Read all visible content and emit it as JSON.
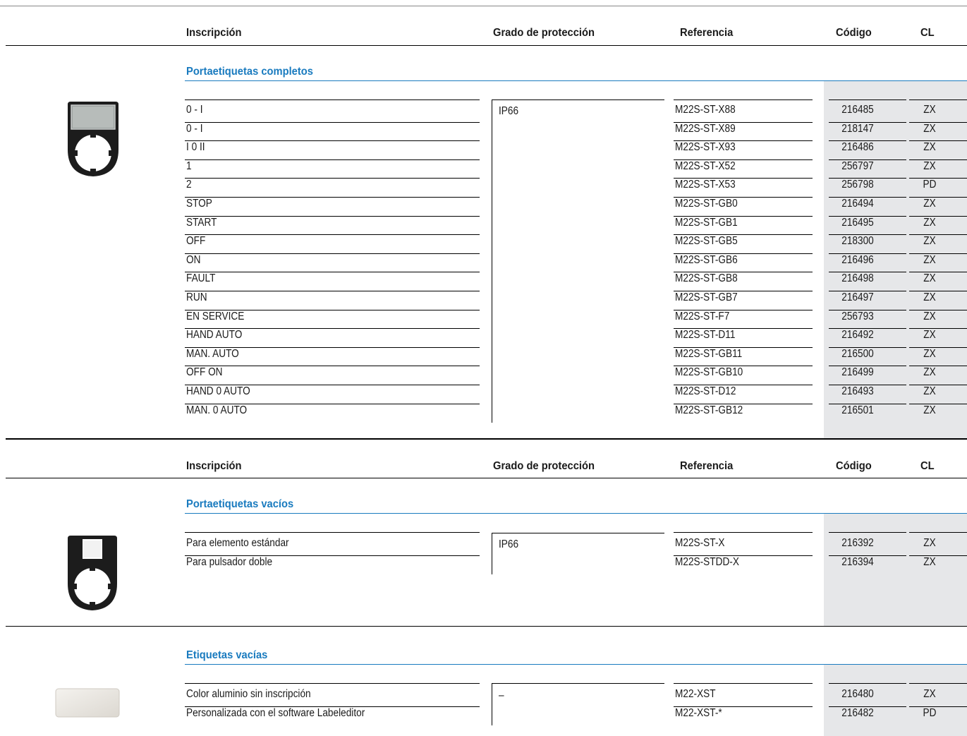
{
  "headers": {
    "inscripcion": "Inscripción",
    "grado": "Grado de protección",
    "referencia": "Referencia",
    "codigo": "Código",
    "cl": "CL"
  },
  "sections": {
    "completos": {
      "title": "Portaetiquetas completos",
      "protection": "IP66",
      "rows": [
        {
          "inscripcion": "0 - I",
          "referencia": "M22S-ST-X88",
          "codigo": "216485",
          "cl": "ZX"
        },
        {
          "inscripcion": "0 - I",
          "referencia": "M22S-ST-X89",
          "codigo": "218147",
          "cl": "ZX"
        },
        {
          "inscripcion": "I 0 II",
          "referencia": "M22S-ST-X93",
          "codigo": "216486",
          "cl": "ZX"
        },
        {
          "inscripcion": "1",
          "referencia": "M22S-ST-X52",
          "codigo": "256797",
          "cl": "ZX"
        },
        {
          "inscripcion": "2",
          "referencia": "M22S-ST-X53",
          "codigo": "256798",
          "cl": "PD"
        },
        {
          "inscripcion": "STOP",
          "referencia": "M22S-ST-GB0",
          "codigo": "216494",
          "cl": "ZX"
        },
        {
          "inscripcion": "START",
          "referencia": "M22S-ST-GB1",
          "codigo": "216495",
          "cl": "ZX"
        },
        {
          "inscripcion": "OFF",
          "referencia": "M22S-ST-GB5",
          "codigo": "218300",
          "cl": "ZX"
        },
        {
          "inscripcion": "ON",
          "referencia": "M22S-ST-GB6",
          "codigo": "216496",
          "cl": "ZX"
        },
        {
          "inscripcion": "FAULT",
          "referencia": "M22S-ST-GB8",
          "codigo": "216498",
          "cl": "ZX"
        },
        {
          "inscripcion": "RUN",
          "referencia": "M22S-ST-GB7",
          "codigo": "216497",
          "cl": "ZX"
        },
        {
          "inscripcion": "EN SERVICE",
          "referencia": "M22S-ST-F7",
          "codigo": "256793",
          "cl": "ZX"
        },
        {
          "inscripcion": "HAND AUTO",
          "referencia": "M22S-ST-D11",
          "codigo": "216492",
          "cl": "ZX"
        },
        {
          "inscripcion": "MAN. AUTO",
          "referencia": "M22S-ST-GB11",
          "codigo": "216500",
          "cl": "ZX"
        },
        {
          "inscripcion": "OFF ON",
          "referencia": "M22S-ST-GB10",
          "codigo": "216499",
          "cl": "ZX"
        },
        {
          "inscripcion": "HAND 0 AUTO",
          "referencia": "M22S-ST-D12",
          "codigo": "216493",
          "cl": "ZX"
        },
        {
          "inscripcion": "MAN. 0 AUTO",
          "referencia": "M22S-ST-GB12",
          "codigo": "216501",
          "cl": "ZX"
        }
      ]
    },
    "vacios": {
      "title": "Portaetiquetas vacíos",
      "protection": "IP66",
      "rows": [
        {
          "inscripcion": "Para elemento estándar",
          "referencia": "M22S-ST-X",
          "codigo": "216392",
          "cl": "ZX"
        },
        {
          "inscripcion": "Para pulsador doble",
          "referencia": "M22S-STDD-X",
          "codigo": "216394",
          "cl": "ZX"
        }
      ]
    },
    "etiquetas": {
      "title": "Etiquetas vacías",
      "protection": "–",
      "rows": [
        {
          "inscripcion": "Color aluminio sin inscripción",
          "referencia": "M22-XST",
          "codigo": "216480",
          "cl": "ZX"
        },
        {
          "inscripcion": "Personalizada con el software Labeleditor",
          "referencia": "M22-XST-*",
          "codigo": "216482",
          "cl": "PD"
        }
      ]
    }
  },
  "colors": {
    "accent": "#1a7bbf",
    "code_column_bg": "#e6e7e9"
  },
  "icons": [
    "label-holder-window-icon",
    "label-holder-empty-icon",
    "blank-label-icon"
  ]
}
